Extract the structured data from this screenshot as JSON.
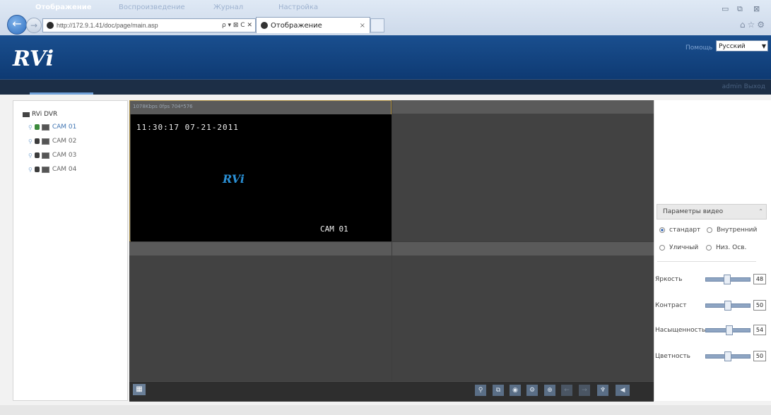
{
  "browser": {
    "url": "http://172.9.1.41/doc/page/main.asp",
    "address_tools": "ρ ▾ ⊠ C ✕",
    "tab_title": "Отображение",
    "tab_close": "×",
    "back_glyph": "←",
    "forward_glyph": "→",
    "window_controls": [
      "▭",
      "⧉",
      "⊠"
    ],
    "fav_icons": "⌂☆⚙"
  },
  "header": {
    "logo": "RVi",
    "help_label": "Помощь",
    "language": "Русский"
  },
  "nav": {
    "items": [
      "Отображение",
      "Воспроизведение",
      "Журнал",
      "Настройка"
    ],
    "user_links": "admin  Выход"
  },
  "device_tree": {
    "root": "RVi DVR",
    "cameras": [
      "CAM 01",
      "CAM 02",
      "CAM 03",
      "CAM 04"
    ]
  },
  "video": {
    "stream_info": "1078Kbps  0fps  704*576",
    "osd_time": "11:30:17 07-21-2011",
    "osd_logo": "RVi",
    "osd_camera": "CAM 01"
  },
  "toolbar": {
    "layout_icon": "layout-grid-icon",
    "buttons": [
      "ptz-icon",
      "capture-icon",
      "record-icon",
      "snapshot-icon",
      "zoom-icon",
      "prev-icon",
      "next-icon",
      "microphone-icon",
      "volume-icon"
    ]
  },
  "video_params": {
    "title": "Параметры видео",
    "modes": [
      {
        "label": "стандарт",
        "selected": true
      },
      {
        "label": "Внутренний",
        "selected": false
      },
      {
        "label": "Уличный",
        "selected": false
      },
      {
        "label": "Низ. Осв.",
        "selected": false
      }
    ],
    "sliders": [
      {
        "label": "Яркость",
        "value": "48",
        "level": 0.48
      },
      {
        "label": "Контраст",
        "value": "50",
        "level": 0.5
      },
      {
        "label": "Насыщенность",
        "value": "54",
        "level": 0.54
      },
      {
        "label": "Цветность",
        "value": "50",
        "level": 0.5
      }
    ]
  }
}
